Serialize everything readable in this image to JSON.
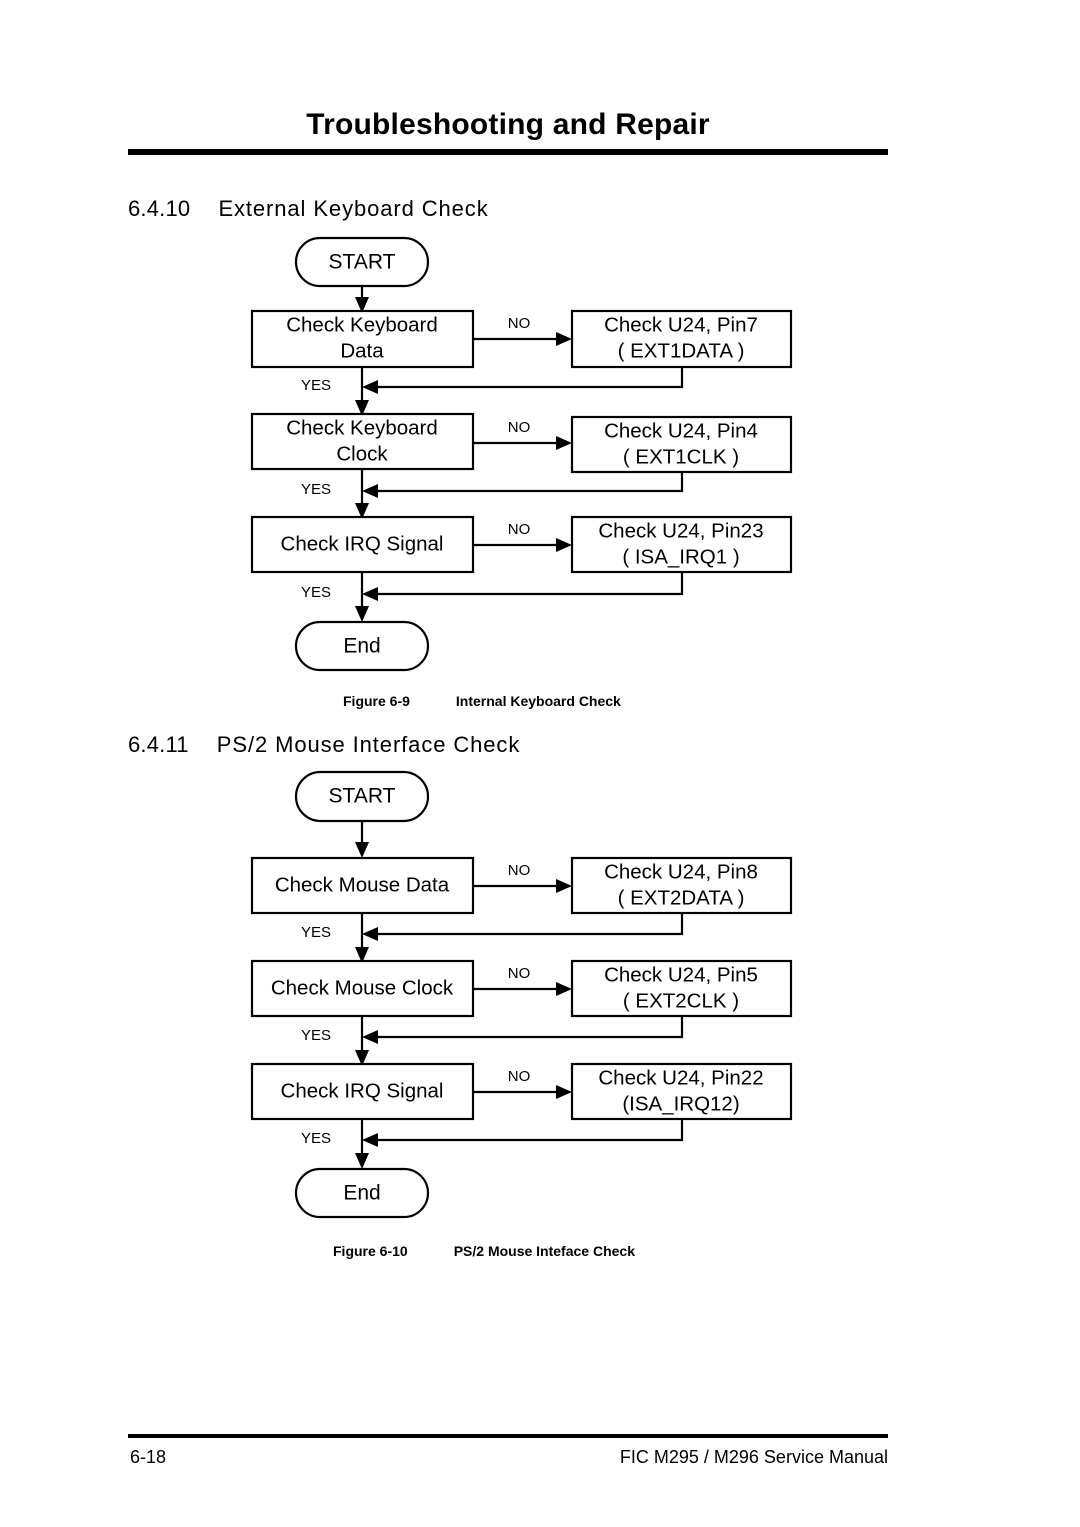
{
  "header": {
    "title": "Troubleshooting and Repair"
  },
  "sections": [
    {
      "number": "6.4.10",
      "title": "External Keyboard Check"
    },
    {
      "number": "6.4.11",
      "title": "PS/2 Mouse Interface Check"
    }
  ],
  "figures": [
    {
      "label": "Figure 6-9",
      "title": "Internal Keyboard Check"
    },
    {
      "label": "Figure 6-10",
      "title": "PS/2 Mouse Inteface Check"
    }
  ],
  "flowchart_keyboard": {
    "start_label": "START",
    "end_label": "End",
    "yes_label": "YES",
    "no_label": "NO",
    "steps": [
      {
        "check_line1": "Check Keyboard",
        "check_line2": "Data",
        "result_line1": "Check U24, Pin7",
        "result_line2": "( EXT1DATA )"
      },
      {
        "check_line1": "Check Keyboard",
        "check_line2": "Clock",
        "result_line1": "Check U24, Pin4",
        "result_line2": "( EXT1CLK )"
      },
      {
        "check_line1": "Check IRQ Signal",
        "check_line2": "",
        "result_line1": "Check U24, Pin23",
        "result_line2": "( ISA_IRQ1 )"
      }
    ]
  },
  "flowchart_mouse": {
    "start_label": "START",
    "end_label": "End",
    "yes_label": "YES",
    "no_label": "NO",
    "steps": [
      {
        "check_line1": "Check Mouse Data",
        "check_line2": "",
        "result_line1": "Check U24, Pin8",
        "result_line2": "( EXT2DATA )"
      },
      {
        "check_line1": "Check Mouse Clock",
        "check_line2": "",
        "result_line1": "Check U24, Pin5",
        "result_line2": "( EXT2CLK )"
      },
      {
        "check_line1": "Check IRQ Signal",
        "check_line2": "",
        "result_line1": "Check U24, Pin22",
        "result_line2": "(ISA_IRQ12)"
      }
    ]
  },
  "footer": {
    "page_number": "6-18",
    "manual_title": "FIC M295 / M296 Service Manual"
  }
}
